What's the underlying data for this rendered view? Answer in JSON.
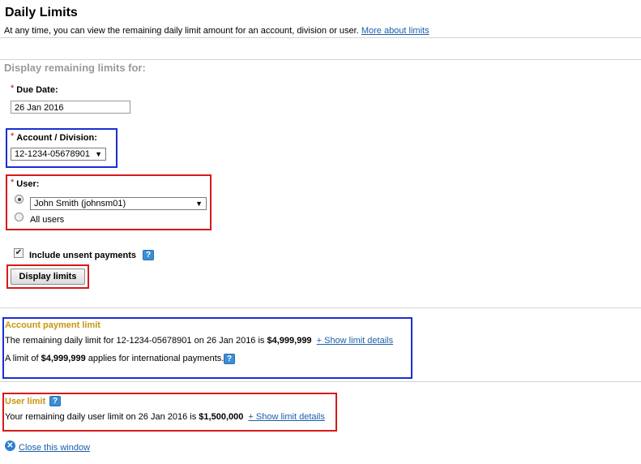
{
  "page": {
    "title": "Daily Limits",
    "intro": "At any time, you can view the remaining daily limit amount for an account, division or user.",
    "intro_link": "More about limits"
  },
  "form": {
    "section_title": "Display remaining limits for:",
    "required_mark": "*",
    "due_date_label": "Due Date:",
    "due_date_value": "26 Jan 2016",
    "account_label": "Account / Division:",
    "account_value": "12-1234-05678901",
    "user_label": "User:",
    "user_selected": "John Smith (johnsm01)",
    "all_users_label": "All users",
    "include_unsent_label": "Include unsent payments",
    "include_unsent_checked": true,
    "display_button": "Display limits"
  },
  "account_limit": {
    "heading": "Account payment limit",
    "line1_prefix": "The remaining daily limit for 12-1234-05678901 on 26 Jan 2016 is",
    "line1_amount": "$4,999,999",
    "line1_link": "+ Show limit details",
    "line2_prefix": "A limit of",
    "line2_amount": "$4,999,999",
    "line2_suffix": "applies for international payments."
  },
  "user_limit": {
    "heading": "User limit",
    "line_prefix": "Your remaining daily user limit on 26 Jan 2016 is",
    "line_amount": "$1,500,000",
    "line_link": "+ Show limit details"
  },
  "footer": {
    "close_link": "Close this window"
  },
  "icons": {
    "help": "help-icon",
    "close": "close-circle-icon",
    "dropdown": "chevron-down-icon"
  },
  "colors": {
    "link": "#1a5fa8",
    "heading_gold": "#c8960a",
    "highlight_blue": "#1a2fd0",
    "highlight_red": "#d51a1a",
    "required": "#cc0000",
    "help_blue": "#3a8fd6"
  }
}
